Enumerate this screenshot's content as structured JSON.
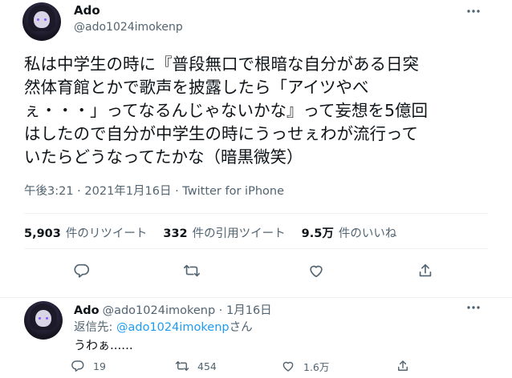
{
  "main_tweet": {
    "author_name": "Ado",
    "author_handle": "@ado1024imokenp",
    "text": "私は中学生の時に『普段無口で根暗な自分がある日突\n然体育館とかで歌声を披露したら「アイツやべ\nぇ・・・」ってなるんじゃないかな』って妄想を5億回\nはしたので自分が中学生の時にうっせぇわが流行って\nいたらどうなってたかな（暗黒微笑）",
    "meta": "午後3:21 · 2021年1月16日 · Twitter for iPhone",
    "stats": {
      "retweets_count": "5,903",
      "retweets_label": "件のリツイート",
      "quotes_count": "332",
      "quotes_label": "件の引用ツイート",
      "likes_count": "9.5万",
      "likes_label": "件のいいね"
    }
  },
  "reply_tweet": {
    "author_name": "Ado",
    "author_handle": "@ado1024imokenp",
    "dot": "·",
    "date": "1月16日",
    "replying_to_prefix": "返信先: ",
    "replying_to_handle": "@ado1024imokenp",
    "replying_to_suffix": "さん",
    "text": "うわぁ......",
    "counts": {
      "replies": "19",
      "retweets": "454",
      "likes": "1.6万"
    }
  },
  "colors": {
    "text": "#0f1419",
    "secondary": "#536471",
    "link": "#1d9bf0",
    "divider": "#eff3f4"
  },
  "icons": [
    "more-icon",
    "reply-icon",
    "retweet-icon",
    "like-icon",
    "share-icon"
  ]
}
